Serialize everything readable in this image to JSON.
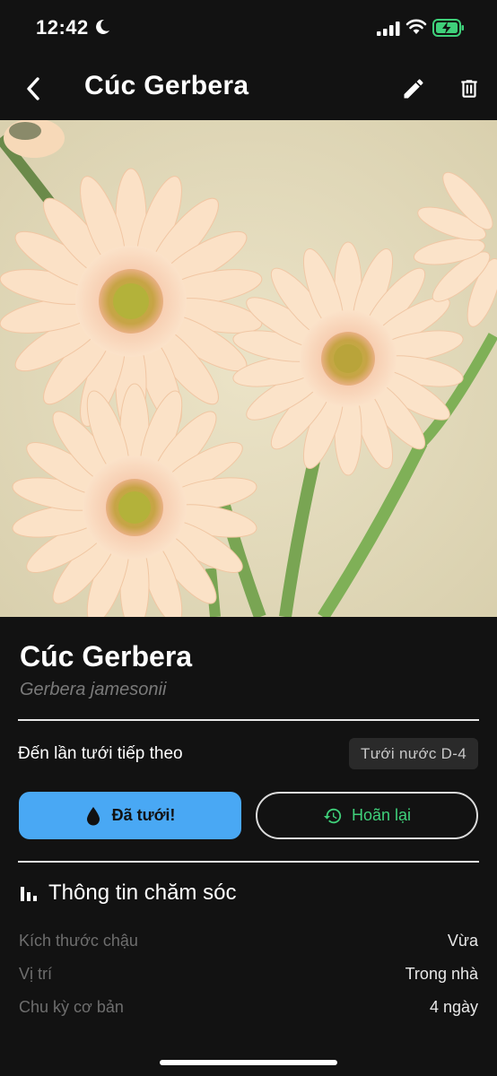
{
  "status_bar": {
    "time": "12:42"
  },
  "app_bar": {
    "title": "Cúc Gerbera"
  },
  "plant": {
    "name": "Cúc Gerbera",
    "scientific_name": "Gerbera jamesonii"
  },
  "watering": {
    "next_label": "Đến lần tưới tiếp theo",
    "badge": "Tưới nước D-4",
    "watered_button": "Đã tưới!",
    "postpone_button": "Hoãn lại"
  },
  "care_info": {
    "title": "Thông tin chăm sóc",
    "rows": [
      {
        "label": "Kích thước chậu",
        "value": "Vừa"
      },
      {
        "label": "Vị trí",
        "value": "Trong nhà"
      },
      {
        "label": "Chu kỳ cơ bản",
        "value": "4 ngày"
      }
    ]
  },
  "colors": {
    "background": "#121212",
    "primary_button": "#49a8f4",
    "postpone_accent": "#3fd07a",
    "battery": "#3fd07a"
  },
  "icons": {
    "status": [
      "moon-icon",
      "signal-icon",
      "wifi-icon",
      "battery-charging-icon"
    ],
    "app_bar": [
      "back-arrow-icon",
      "edit-pencil-icon",
      "trash-icon"
    ],
    "buttons": [
      "water-drop-icon",
      "history-icon"
    ],
    "section": [
      "bar-chart-icon"
    ]
  }
}
